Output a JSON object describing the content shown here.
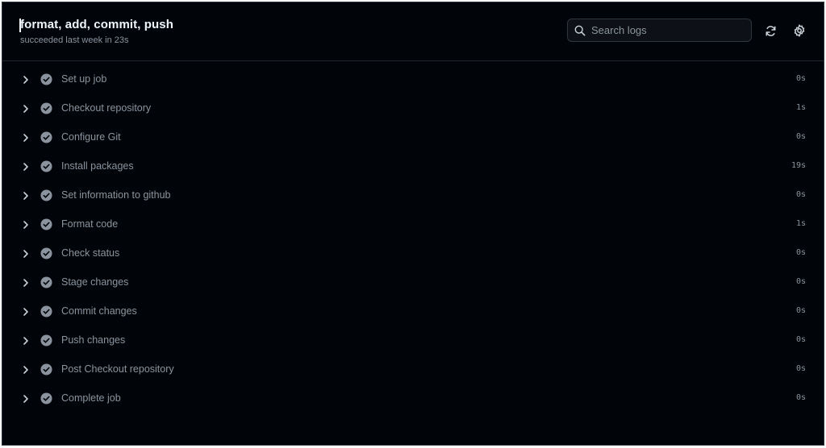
{
  "header": {
    "title": "format, add, commit, push",
    "subtitle": "succeeded last week in 23s"
  },
  "search": {
    "placeholder": "Search logs"
  },
  "icons": {
    "refresh": "refresh-icon",
    "settings": "gear-icon",
    "search": "search-icon"
  },
  "colors": {
    "background": "#010409",
    "text_muted": "#8b949e",
    "title": "#f0f6fc",
    "check": "#8b949e"
  },
  "steps": [
    {
      "label": "Set up job",
      "duration": "0s"
    },
    {
      "label": "Checkout repository",
      "duration": "1s"
    },
    {
      "label": "Configure Git",
      "duration": "0s"
    },
    {
      "label": "Install packages",
      "duration": "19s"
    },
    {
      "label": "Set information to github",
      "duration": "0s"
    },
    {
      "label": "Format code",
      "duration": "1s"
    },
    {
      "label": "Check status",
      "duration": "0s"
    },
    {
      "label": "Stage changes",
      "duration": "0s"
    },
    {
      "label": "Commit changes",
      "duration": "0s"
    },
    {
      "label": "Push changes",
      "duration": "0s"
    },
    {
      "label": "Post Checkout repository",
      "duration": "0s"
    },
    {
      "label": "Complete job",
      "duration": "0s"
    }
  ]
}
